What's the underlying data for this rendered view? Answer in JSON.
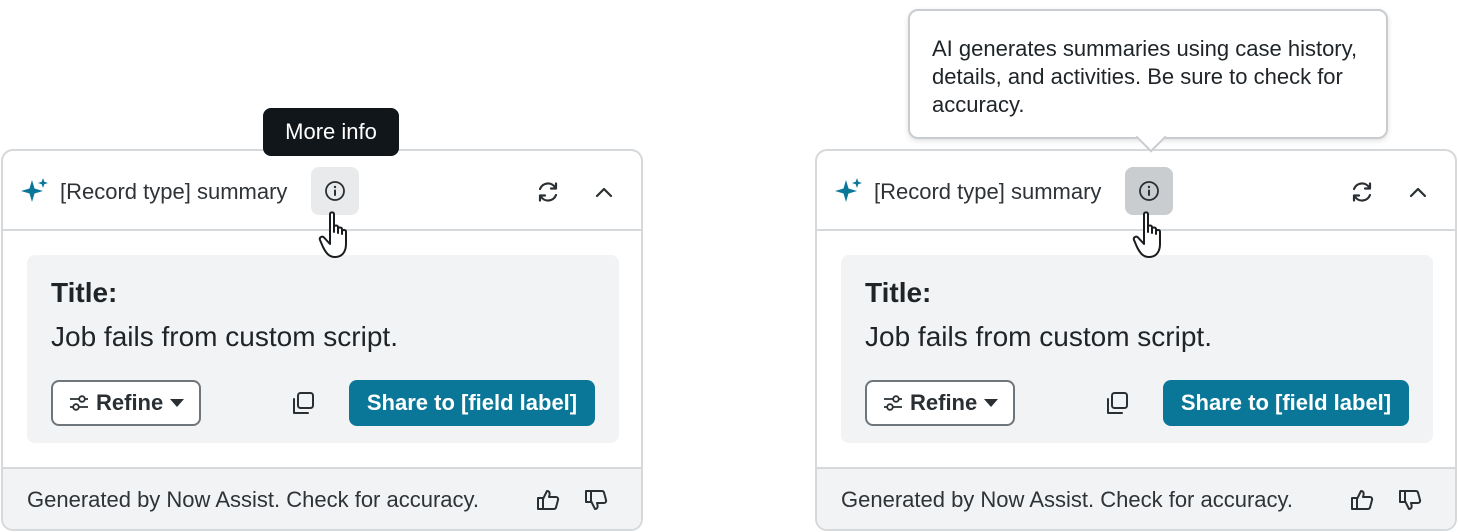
{
  "colors": {
    "accent": "#0a7799",
    "sparkle": "#0a7799",
    "tooltip_bg": "#11161a",
    "panel_bg": "#f2f3f4",
    "border": "#d5d9dc"
  },
  "tooltip": {
    "label": "More info"
  },
  "popover": {
    "text": "AI generates summaries using case history, details, and activities. Be sure to check for accuracy."
  },
  "cards": [
    {
      "header": {
        "title": "[Record type] summary",
        "info_icon": "info-icon",
        "refresh_icon": "refresh-icon",
        "collapse_icon": "chevron-up-icon"
      },
      "body": {
        "title": "Title:",
        "text": "Job fails from custom script."
      },
      "actions": {
        "refine_label": "Refine",
        "share_label": "Share to [field label]",
        "copy_icon": "copy-icon"
      },
      "footer": {
        "text": "Generated by Now Assist. Check for accuracy."
      }
    },
    {
      "header": {
        "title": "[Record type] summary",
        "info_icon": "info-icon",
        "refresh_icon": "refresh-icon",
        "collapse_icon": "chevron-up-icon"
      },
      "body": {
        "title": "Title:",
        "text": "Job fails from custom script."
      },
      "actions": {
        "refine_label": "Refine",
        "share_label": "Share to [field label]",
        "copy_icon": "copy-icon"
      },
      "footer": {
        "text": "Generated by Now Assist. Check for accuracy."
      }
    }
  ]
}
